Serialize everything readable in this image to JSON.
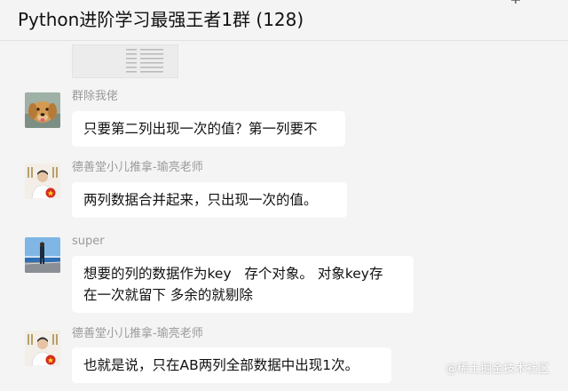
{
  "header": {
    "title": "Python进阶学习最强王者1群 (128)",
    "more_icon": "pin-icon"
  },
  "messages": [
    {
      "sender": "群除我佬",
      "avatar": "golden-retriever-photo",
      "lines": [
        "只要第二列出现一次的值？第一列要不"
      ]
    },
    {
      "sender": "德善堂小儿推拿-瑜亮老师",
      "avatar": "teacher-photo",
      "lines": [
        "两列数据合并起来，只出现一次的值。"
      ]
    },
    {
      "sender": "super",
      "avatar": "seaside-photo",
      "lines": [
        "想要的列的数据作为key   存个对象。 对象key存",
        "在一次就留下 多余的就剔除"
      ]
    },
    {
      "sender": "德善堂小儿推拿-瑜亮老师",
      "avatar": "teacher-photo",
      "lines": [
        "也就是说，只在AB两列全部数据中出现1次。"
      ]
    }
  ],
  "watermark": "@稀土掘金技术社区"
}
